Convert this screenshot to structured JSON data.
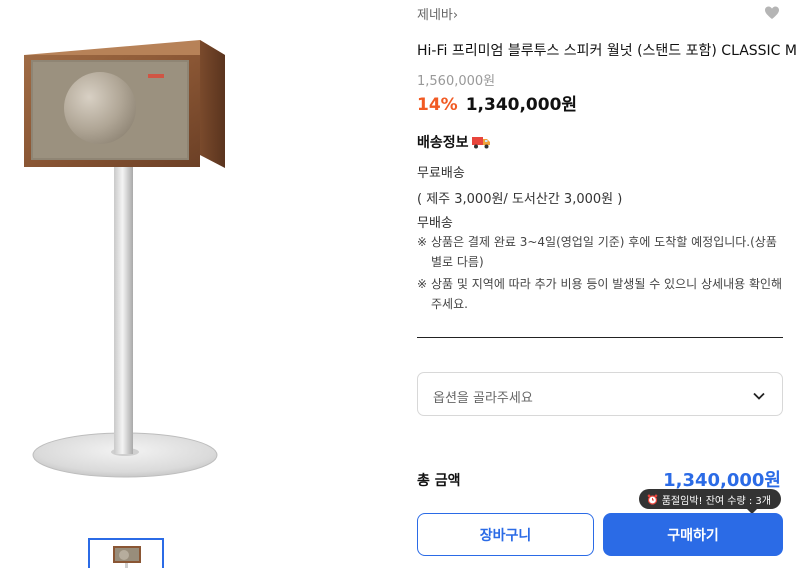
{
  "product": {
    "brand": "제네바",
    "brand_chevron": "›",
    "title": "Hi-Fi 프리미엄 블루투스 스피커 월넛 (스탠드 포함) CLASSIC M",
    "original_price": "1,560,000원",
    "discount": "14%",
    "sale_price": "1,340,000원",
    "image_subject": "walnut speaker on stand",
    "wish_icon": "heart-icon"
  },
  "shipping": {
    "heading": "배송정보",
    "heading_icon": "truck-icon",
    "type": "무료배송",
    "extra_fee": "( 제주 3,000원/ 도서산간 3,000원 )",
    "method": "무배송",
    "notes": [
      {
        "mark": "※",
        "text": "상품은 결제 완료 3~4일(영업일 기준) 후에 도착할 예정입니다.(상품별로 다름)"
      },
      {
        "mark": "※",
        "text": "상품 및 지역에 따라 추가 비용 등이 발생될 수 있으니 상세내용 확인해주세요."
      }
    ]
  },
  "option": {
    "placeholder": "옵션을 골라주세요"
  },
  "total": {
    "label": "총 금액",
    "price": "1,340,000원"
  },
  "stock_badge": {
    "text": "품절임박! 잔여 수량 : 3개",
    "icon": "alarm-clock-icon"
  },
  "buttons": {
    "cart": "장바구니",
    "buy": "구매하기"
  },
  "colors": {
    "accent": "#2b6be6",
    "discount": "#f15a23"
  }
}
